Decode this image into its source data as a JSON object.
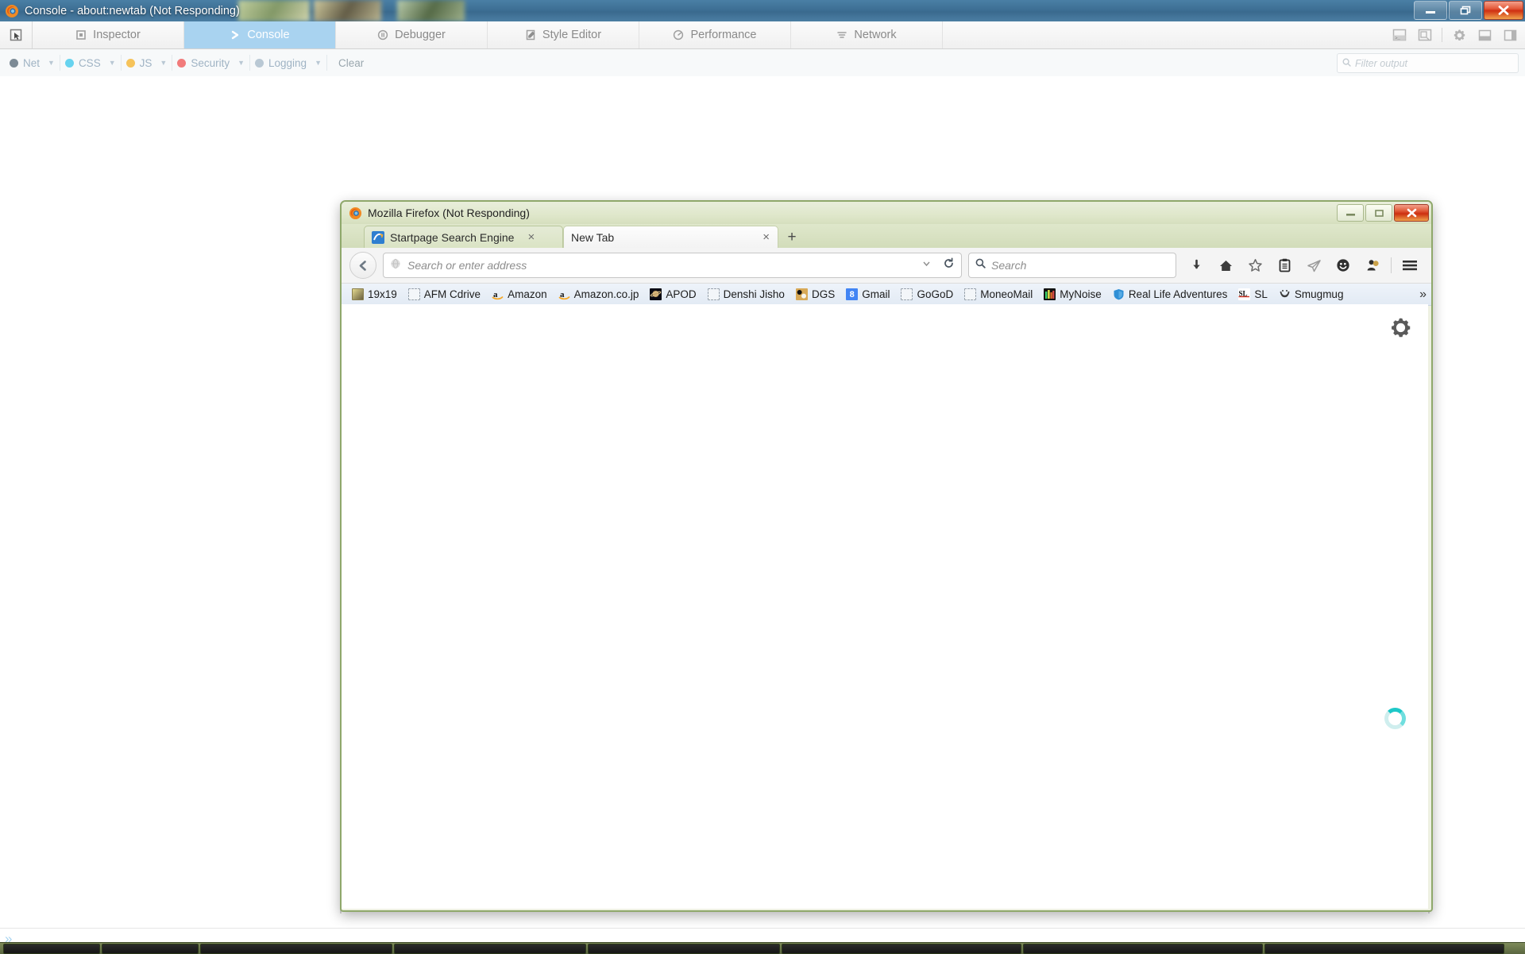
{
  "os_window": {
    "title": "Console - about:newtab (Not Responding)",
    "icon": "firefox-icon",
    "controls": {
      "minimize": "minimize-icon",
      "restore": "restore-icon",
      "close": "close-icon"
    }
  },
  "devtools": {
    "picker_icon": "element-picker-icon",
    "tabs": [
      {
        "label": "Inspector",
        "icon": "inspector-icon",
        "active": false
      },
      {
        "label": "Console",
        "icon": "console-chevron-icon",
        "active": true
      },
      {
        "label": "Debugger",
        "icon": "debugger-pause-icon",
        "active": false
      },
      {
        "label": "Style Editor",
        "icon": "style-editor-icon",
        "active": false
      },
      {
        "label": "Performance",
        "icon": "performance-icon",
        "active": false
      },
      {
        "label": "Network",
        "icon": "network-icon",
        "active": false
      }
    ],
    "toolbar_icons": [
      "split-console-icon",
      "responsive-design-mode-icon",
      "settings-gear-icon",
      "dock-bottom-icon",
      "dock-side-icon"
    ],
    "filters": [
      {
        "label": "Net",
        "color": "#7d8b96"
      },
      {
        "label": "CSS",
        "color": "#67d3ef"
      },
      {
        "label": "JS",
        "color": "#f6c35a"
      },
      {
        "label": "Security",
        "color": "#f17b7b"
      },
      {
        "label": "Logging",
        "color": "#b9c8d4"
      }
    ],
    "clear_label": "Clear",
    "filter_output_placeholder": "Filter output",
    "filter_output_value": "",
    "filter_search_icon": "search-icon",
    "console_prompt": "»"
  },
  "firefox": {
    "title": "Mozilla Firefox (Not Responding)",
    "icon": "firefox-icon",
    "controls": {
      "minimize": "minimize-icon",
      "restore": "restore-icon",
      "close": "close-icon"
    },
    "tabs": [
      {
        "label": "Startpage Search Engine",
        "favicon": "startpage-favicon",
        "active": false,
        "close": "×"
      },
      {
        "label": "New Tab",
        "favicon": "",
        "active": true,
        "close": "×"
      }
    ],
    "new_tab_label": "+",
    "navbar": {
      "back_icon": "back-arrow-icon",
      "urlbar_placeholder": "Search or enter address",
      "urlbar_value": "",
      "identity_icon": "globe-icon",
      "dropmarker_icon": "chevron-down-icon",
      "reload_icon": "reload-icon",
      "search_placeholder": "Search",
      "search_value": "",
      "search_icon": "search-icon",
      "icons": [
        "download-arrow-icon",
        "home-icon",
        "bookmark-star-icon",
        "clipboard-icon",
        "paper-plane-icon",
        "smiley-face-icon",
        "person-icon",
        "hamburger-menu-icon"
      ]
    },
    "bookmarks": [
      {
        "label": "19x19",
        "icon": "pixel-icon"
      },
      {
        "label": "AFM Cdrive",
        "icon": "blank-favicon"
      },
      {
        "label": "Amazon",
        "icon": "amazon-icon"
      },
      {
        "label": "Amazon.co.jp",
        "icon": "amazon-icon"
      },
      {
        "label": "APOD",
        "icon": "apod-planet-icon"
      },
      {
        "label": "Denshi Jisho",
        "icon": "blank-favicon"
      },
      {
        "label": "DGS",
        "icon": "dgs-go-board-icon"
      },
      {
        "label": "Gmail",
        "icon": "gmail-icon"
      },
      {
        "label": "GoGoD",
        "icon": "blank-favicon"
      },
      {
        "label": "MoneoMail",
        "icon": "blank-favicon"
      },
      {
        "label": "MyNoise",
        "icon": "mynoise-icon"
      },
      {
        "label": "Real Life Adventures",
        "icon": "shield-icon"
      },
      {
        "label": "SL",
        "icon": "sensei-library-icon"
      },
      {
        "label": "Smugmug",
        "icon": "smugmug-icon"
      }
    ],
    "bookmarks_overflow": "»",
    "content": {
      "gear_icon": "settings-gear-icon",
      "spinner_icon": "loading-spinner-icon",
      "spinner_color": "#1ec8c8"
    }
  }
}
